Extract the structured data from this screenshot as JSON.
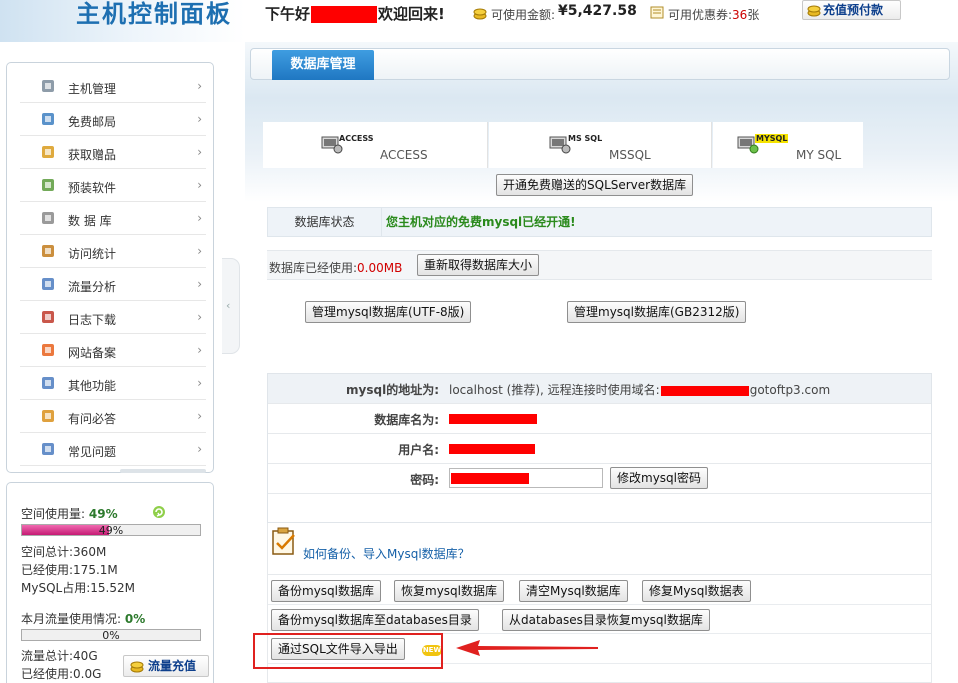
{
  "header": {
    "logo_text": "主机控制面板",
    "greeting_prefix": "下午好",
    "greeting_suffix": "欢迎回来!",
    "money_label": "可使用金额:",
    "money_value": "¥5,427.58",
    "ticket_label": "可用优惠券:",
    "ticket_count": "36",
    "ticket_unit": "张",
    "prepay_button": "充值预付款"
  },
  "sidebar": {
    "items": [
      {
        "label": "主机管理",
        "icon": "host-icon"
      },
      {
        "label": "免费邮局",
        "icon": "mail-icon"
      },
      {
        "label": "获取赠品",
        "icon": "gift-icon"
      },
      {
        "label": "预装软件",
        "icon": "software-icon"
      },
      {
        "label": "数 据 库",
        "icon": "database-icon"
      },
      {
        "label": "访问统计",
        "icon": "stats-icon"
      },
      {
        "label": "流量分析",
        "icon": "traffic-icon"
      },
      {
        "label": "日志下载",
        "icon": "calendar-icon"
      },
      {
        "label": "网站备案",
        "icon": "record-icon"
      },
      {
        "label": "其他功能",
        "icon": "wrench-icon"
      },
      {
        "label": "有问必答",
        "icon": "user-help-icon"
      },
      {
        "label": "常见问题",
        "icon": "faq-icon"
      }
    ],
    "arrow": "›"
  },
  "usage": {
    "space_label": "空间使用量:",
    "space_percent": "49%",
    "space_fraction": 0.49,
    "space_total": "空间总计:360M",
    "space_used": "已经使用:175.1M",
    "mysql_used": "MySQL占用:15.52M",
    "flow_label": "本月流量使用情况:",
    "flow_percent": "0%",
    "flow_fraction": 0,
    "flow_total": "流量总计:40G",
    "flow_used": "已经使用:0.0G",
    "flow_button": "流量充值"
  },
  "main": {
    "tab_label": "数据库管理",
    "db_types": [
      {
        "tag": "ACCESS",
        "label": "ACCESS"
      },
      {
        "tag": "MS SQL",
        "label": "MSSQL"
      },
      {
        "tag": "MYSQL",
        "label": "MY SQL"
      }
    ],
    "free_sqlserver_button": "开通免费赠送的SQLServer数据库",
    "status_label": "数据库状态",
    "status_value": "您主机对应的免费mysql已经开通!",
    "size_label": "数据库已经使用:",
    "size_value": "0.00MB",
    "refresh_size_button": "重新取得数据库大小",
    "manage_utf8_button": "管理mysql数据库(UTF-8版)",
    "manage_gb2312_button": "管理mysql数据库(GB2312版)",
    "info": {
      "address_key": "mysql的地址为:",
      "address_value": "localhost (推荐), 远程连接时使用域名:",
      "address_domain_tail": "gotoftp3.com",
      "dbname_key": "数据库名为:",
      "user_key": "用户名:",
      "password_key": "密码:",
      "change_password_button": "修改mysql密码"
    },
    "help_link": "如何备份、导入Mysql数据库？",
    "ops": {
      "backup": "备份mysql数据库",
      "restore": "恢复mysql数据库",
      "clear": "清空Mysql数据库",
      "repair": "修复Mysql数据表",
      "backup_to_dir": "备份mysql数据库至databases目录",
      "restore_from_dir": "从databases目录恢复mysql数据库",
      "import_export_sql": "通过SQL文件导入导出"
    },
    "new_badge": "NEW"
  }
}
